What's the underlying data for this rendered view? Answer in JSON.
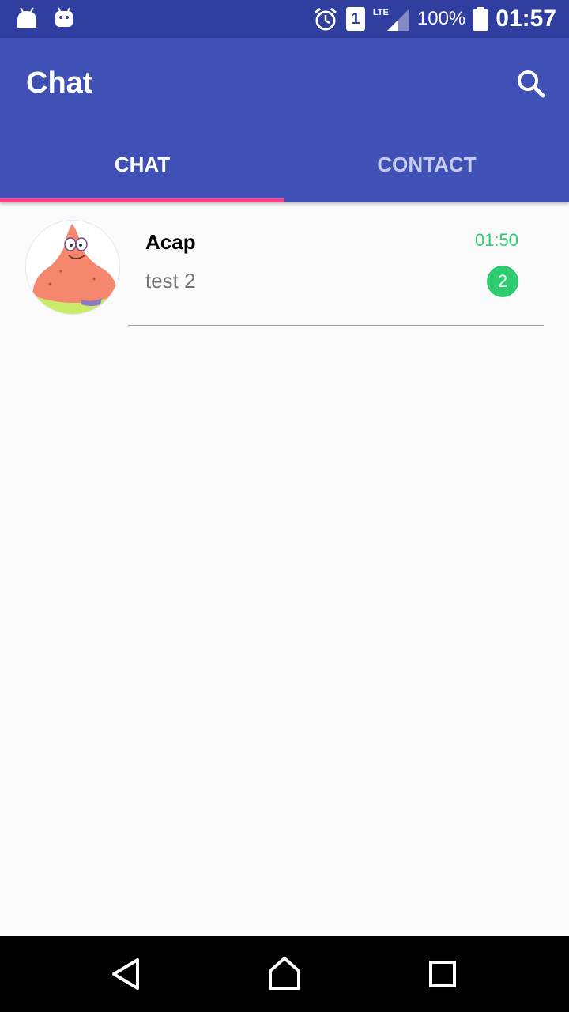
{
  "status_bar": {
    "sim_slot": "1",
    "network": "LTE",
    "battery_percent": "100%",
    "time": "01:57"
  },
  "app_bar": {
    "title": "Chat"
  },
  "tabs": [
    {
      "label": "CHAT",
      "selected": true
    },
    {
      "label": "CONTACT",
      "selected": false
    }
  ],
  "chats": [
    {
      "name": "Acap",
      "last_message": "test 2",
      "time": "01:50",
      "unread_count": "2"
    }
  ],
  "colors": {
    "status_bar": "#303f9f",
    "primary": "#3f51b5",
    "accent": "#ff4081",
    "unread": "#2ecc71",
    "background": "#fafafa"
  },
  "icons": {
    "status_left": [
      "android-icon",
      "android-debug-icon"
    ],
    "status_right": [
      "alarm-icon",
      "sim-icon",
      "signal-icon",
      "battery-icon"
    ],
    "app_bar": "search-icon",
    "nav": [
      "back-icon",
      "home-icon",
      "recents-icon"
    ]
  }
}
